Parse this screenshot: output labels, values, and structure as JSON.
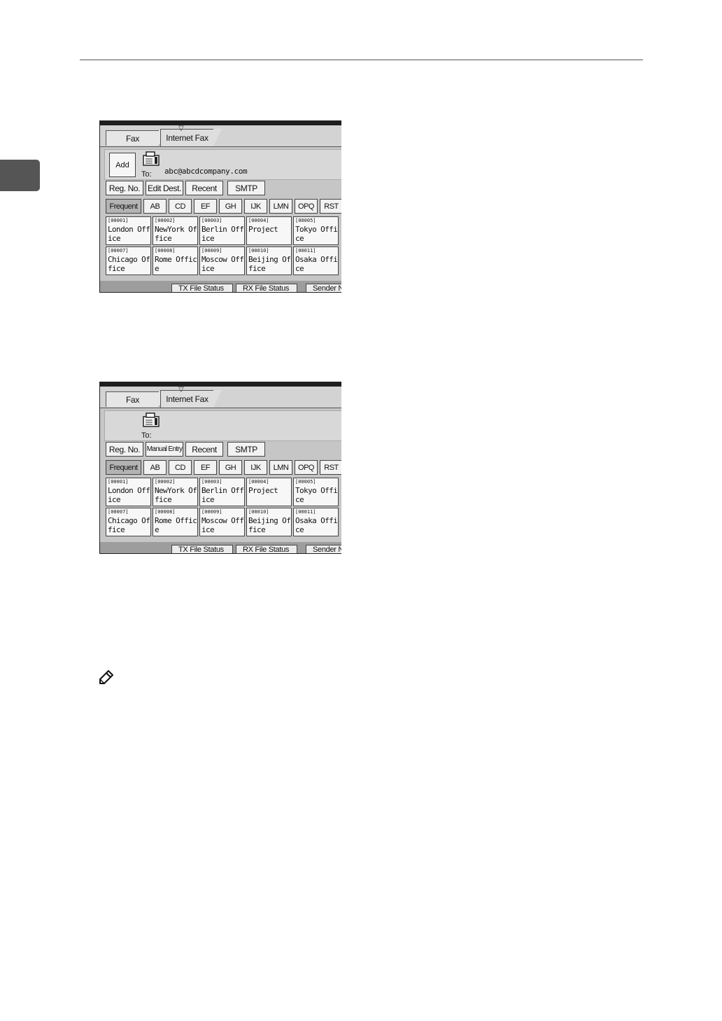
{
  "screen1": {
    "tabs": [
      "Fax",
      "Internet Fax"
    ],
    "add_label": "Add",
    "to_label": "To:",
    "to_value": "abc@abcdcompany.com",
    "buttons": [
      "Reg. No.",
      "Edit Dest.",
      "Recent",
      "SMTP"
    ],
    "index_tabs": [
      "Frequent",
      "AB",
      "CD",
      "EF",
      "GH",
      "IJK",
      "LMN",
      "OPQ",
      "RST"
    ],
    "destinations": [
      {
        "num": "[00001]",
        "name": "London Office"
      },
      {
        "num": "[00002]",
        "name": "NewYork Office"
      },
      {
        "num": "[00003]",
        "name": "Berlin Office"
      },
      {
        "num": "[00004]",
        "name": "Project"
      },
      {
        "num": "[00005]",
        "name": "Tokyo Office"
      },
      {
        "num": "[00007]",
        "name": "Chicago Office"
      },
      {
        "num": "[00008]",
        "name": "Rome Office"
      },
      {
        "num": "[00009]",
        "name": "Moscow Office"
      },
      {
        "num": "[00010]",
        "name": "Beijing Office"
      },
      {
        "num": "[00011]",
        "name": "Osaka Office"
      }
    ],
    "status_buttons": [
      "TX File Status",
      "RX File Status",
      "Sender N"
    ]
  },
  "screen2": {
    "tabs": [
      "Fax",
      "Internet Fax"
    ],
    "to_label": "To:",
    "buttons": [
      "Reg. No.",
      "Manual Entry",
      "Recent",
      "SMTP"
    ],
    "index_tabs": [
      "Frequent",
      "AB",
      "CD",
      "EF",
      "GH",
      "IJK",
      "LMN",
      "OPQ",
      "RST"
    ],
    "destinations": [
      {
        "num": "[00001]",
        "name": "London Office"
      },
      {
        "num": "[00002]",
        "name": "NewYork Office"
      },
      {
        "num": "[00003]",
        "name": "Berlin Office"
      },
      {
        "num": "[00004]",
        "name": "Project"
      },
      {
        "num": "[00005]",
        "name": "Tokyo Office"
      },
      {
        "num": "[00007]",
        "name": "Chicago Office"
      },
      {
        "num": "[00008]",
        "name": "Rome Office"
      },
      {
        "num": "[00009]",
        "name": "Moscow Office"
      },
      {
        "num": "[00010]",
        "name": "Beijing Office"
      },
      {
        "num": "[00011]",
        "name": "Osaka Office"
      }
    ],
    "status_buttons": [
      "TX File Status",
      "RX File Status",
      "Sender N"
    ]
  },
  "icons": [
    "fax-machine-icon",
    "note-pencil-icon",
    "tab-triangle-icon"
  ]
}
